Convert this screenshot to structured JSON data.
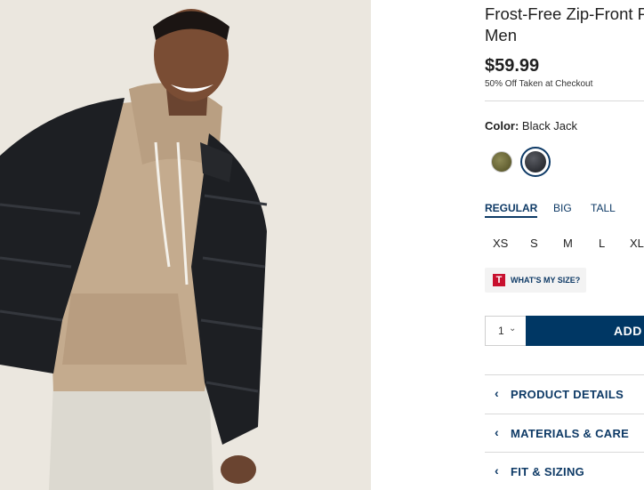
{
  "product": {
    "title_line1": "Frost-Free Zip-Front P",
    "title_line2": "Men",
    "price": "$59.99",
    "promo": "50% Off Taken at Checkout"
  },
  "color": {
    "label": "Color:",
    "selected": "Black Jack",
    "swatches": [
      {
        "name": "olive",
        "hex": "#6f6c3c"
      },
      {
        "name": "black-jack",
        "hex": "#34363b",
        "selected": true
      }
    ],
    "accent": "#0e3a66"
  },
  "fit_tabs": [
    "REGULAR",
    "BIG",
    "TALL"
  ],
  "sizes": [
    "XS",
    "S",
    "M",
    "L",
    "XL"
  ],
  "whats_my_size": {
    "badge": "T",
    "label": "WHAT'S MY SIZE?"
  },
  "cart": {
    "quantity": "1",
    "add_label": "ADD"
  },
  "accordion": [
    {
      "label": "PRODUCT DETAILS"
    },
    {
      "label": "MATERIALS & CARE"
    },
    {
      "label": "FIT & SIZING"
    }
  ]
}
